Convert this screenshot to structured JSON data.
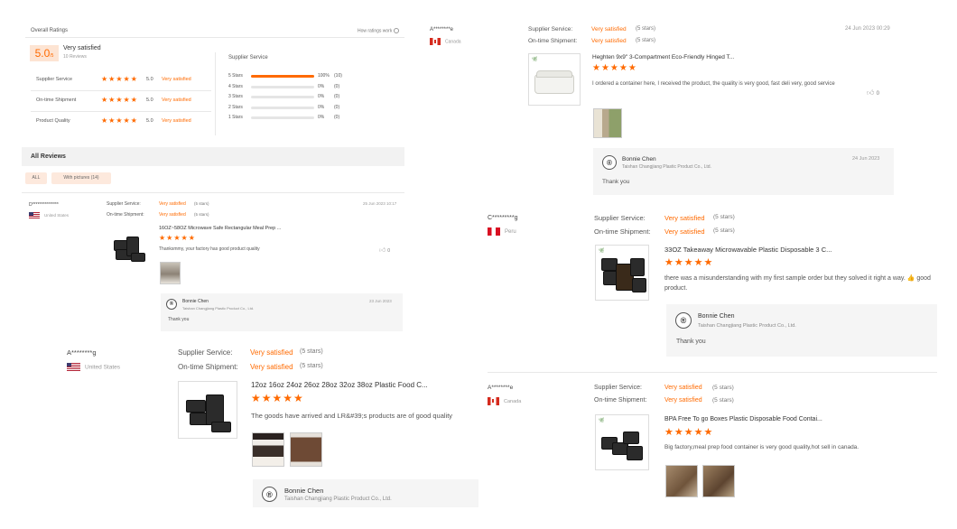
{
  "overall": {
    "title": "Overall Ratings",
    "score": "5.0",
    "score_suffix": "/5",
    "summary": "Very satisfied",
    "reviews_count": "10 Reviews",
    "how_link": "How ratings work",
    "help_icon": "help-circle-icon",
    "metrics": [
      {
        "label": "Supplier Service",
        "stars": "★★★★★",
        "score": "5.0",
        "word": "Very satisfied"
      },
      {
        "label": "On-time Shipment",
        "stars": "★★★★★",
        "score": "5.0",
        "word": "Very satisfied"
      },
      {
        "label": "Product Quality",
        "stars": "★★★★★",
        "score": "5.0",
        "word": "Very satisfied"
      }
    ],
    "breakdown_title": "Supplier Service",
    "breakdown": [
      {
        "label": "5 Stars",
        "pct": "100%",
        "count": "(10)",
        "fill": 1.0
      },
      {
        "label": "4 Stars",
        "pct": "0%",
        "count": "(0)",
        "fill": 0
      },
      {
        "label": "3 Stars",
        "pct": "0%",
        "count": "(0)",
        "fill": 0
      },
      {
        "label": "2 Stars",
        "pct": "0%",
        "count": "(0)",
        "fill": 0
      },
      {
        "label": "1 Stars",
        "pct": "0%",
        "count": "(0)",
        "fill": 0
      }
    ]
  },
  "all_reviews": {
    "title": "All Reviews",
    "filter_all": "ALL",
    "filter_pictures": "With pictures (14)"
  },
  "common": {
    "supplier_service": "Supplier Service:",
    "ontime": "On-time Shipment:",
    "very_satisfied": "Very satisfied",
    "five_stars": "(5 stars)",
    "stars": "★★★★★",
    "thumbs": "0",
    "thumbs_icon": "thumbs-up-icon",
    "reply_name": "Bonnie Chen",
    "reply_company": "Taishan Changjiang Plastic Product Co., Ltd.",
    "reply_text": "Thank you"
  },
  "reviews": [
    {
      "user": "A********e",
      "country": "Canada",
      "date": "24 Jun 2023 00:29",
      "product": "Heghten 9x9\" 3-Compartment Eco-Friendly Hinged T...",
      "text": "I ordered a container here, I received the product, the quality is very good, fast deli very, good service",
      "reply_date": "24 Jun 2023"
    },
    {
      "user": "D***************",
      "country": "United States",
      "date": "25 Jun 2023 10:17",
      "product": "16OZ~58OZ Microwave Safe Rectangular Meal Prep ...",
      "text": "Thanksmmy, your factory has good product quality",
      "reply_date": "23 Jun 2023"
    },
    {
      "user": "C*********g",
      "country": "Peru",
      "product": "33OZ Takeaway Microwavable Plastic Disposable 3 C...",
      "text": "there was a misunderstanding with my first sample order but they solved it right a way. 👍 good product."
    },
    {
      "user": "A********g",
      "country": "United States",
      "product": "12oz 16oz 24oz 26oz 28oz 32oz 38oz Plastic Food C...",
      "text": "The goods have arrived and LR&#39;s products are of good quality"
    },
    {
      "user": "A********e",
      "country": "Canada",
      "product": "BPA Free To go Boxes Plastic Disposable Food Contai...",
      "text": "Big factory,meal prep food container is very good quality,hot sell in canada."
    }
  ]
}
